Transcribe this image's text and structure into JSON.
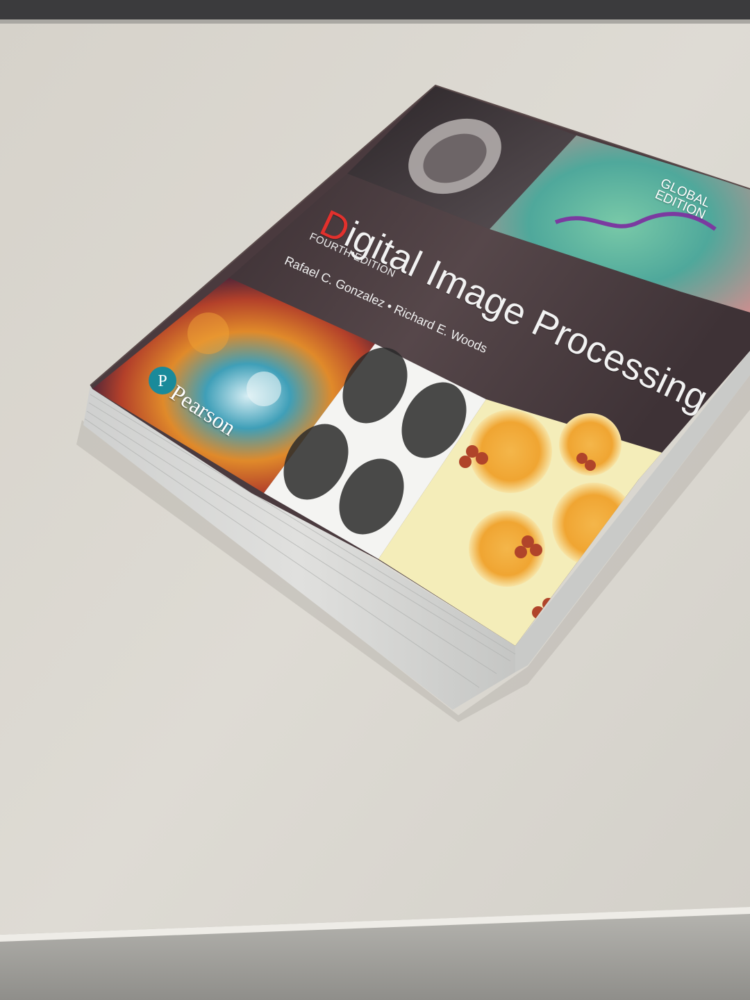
{
  "book": {
    "title_initial": "D",
    "title_rest": "igital Image Processing",
    "edition": "FOURTH EDITION",
    "authors": "Rafael C. Gonzalez • Richard E. Woods",
    "badge_line1": "GLOBAL",
    "badge_line2": "EDITION",
    "publisher": "Pearson"
  },
  "colors": {
    "title_initial": "#e2312d",
    "cover_band": "#4a3a3e",
    "publisher_logo": "#1a8a9a",
    "desk": "#d9d6cf"
  }
}
